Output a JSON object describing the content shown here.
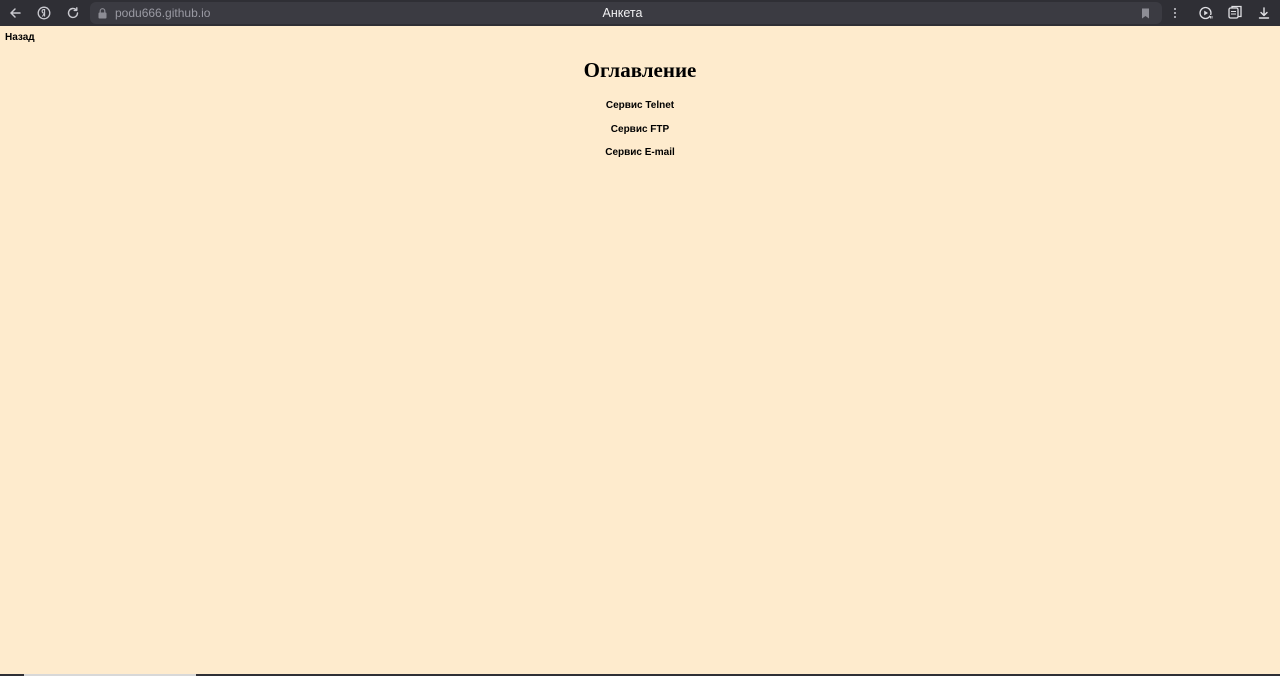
{
  "browser": {
    "url": "podu666.github.io",
    "tab_title": "Анкета",
    "icons": {
      "back": "arrow-left-icon",
      "yandex": "yandex-logo-icon",
      "reload": "reload-icon",
      "lock": "lock-icon",
      "bookmark": "bookmark-icon",
      "menu": "kebab-menu-icon",
      "media": "media-play-icon",
      "reader": "reader-mode-icon",
      "download": "download-icon"
    },
    "colors": {
      "chrome_bg": "#2f2f35",
      "address_bg": "#3b3b42"
    }
  },
  "page": {
    "background": "#feebcd",
    "back_link": "Назад",
    "title": "Оглавление",
    "toc_items": [
      "Сервис Telnet",
      "Сервис FTP",
      "Сервис E-mail"
    ]
  }
}
